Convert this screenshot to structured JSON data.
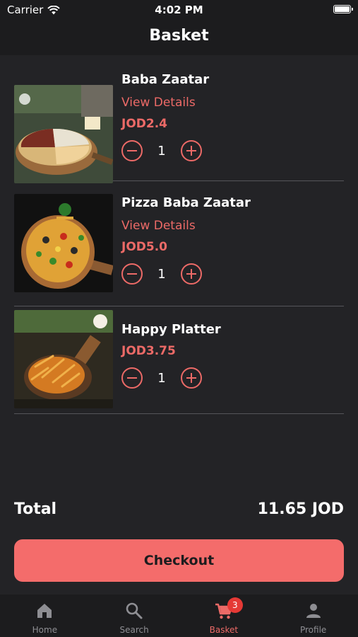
{
  "status_bar": {
    "carrier": "Carrier",
    "time": "4:02 PM"
  },
  "header": {
    "title": "Basket"
  },
  "items": [
    {
      "name": "Baba Zaatar",
      "details_label": "View Details",
      "price": "JOD2.4",
      "quantity": "1"
    },
    {
      "name": "Pizza Baba Zaatar",
      "details_label": "View Details",
      "price": "JOD5.0",
      "quantity": "1"
    },
    {
      "name": "Happy Platter",
      "price": "JOD3.75",
      "quantity": "1"
    }
  ],
  "summary": {
    "total_label": "Total",
    "total_value": "11.65 JOD"
  },
  "checkout": {
    "label": "Checkout"
  },
  "tab_bar": {
    "tabs": [
      {
        "label": "Home",
        "icon": "home-icon"
      },
      {
        "label": "Search",
        "icon": "search-icon"
      },
      {
        "label": "Basket",
        "icon": "cart-icon",
        "badge": "3",
        "active": true
      },
      {
        "label": "Profile",
        "icon": "person-icon"
      }
    ]
  },
  "colors": {
    "accent": "#ec6a67",
    "checkout_button": "#f46c6b",
    "background": "#232326",
    "bar": "#1c1c1e",
    "badge": "#e53935"
  }
}
